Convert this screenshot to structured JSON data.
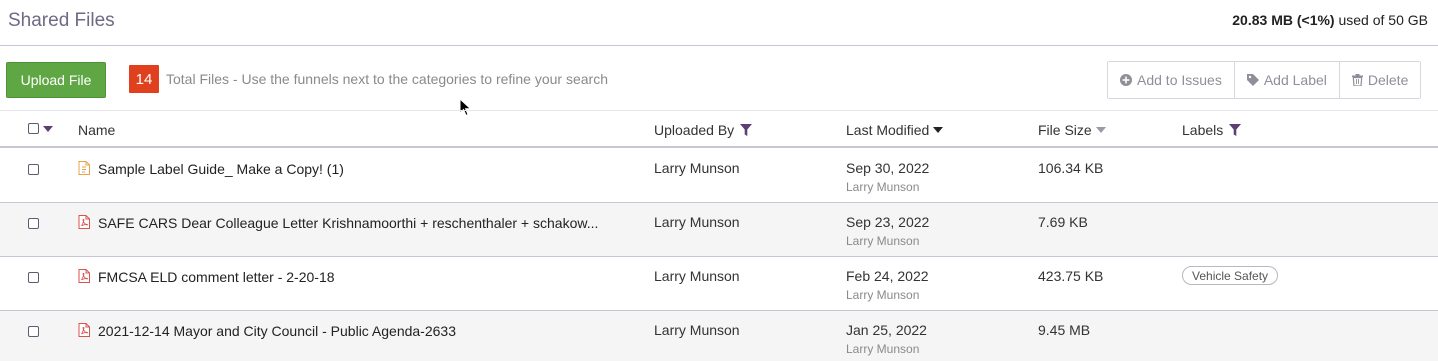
{
  "header": {
    "title": "Shared Files",
    "storage_used": "20.83 MB (<1%)",
    "storage_suffix": " used of 50 GB"
  },
  "toolbar": {
    "upload_label": "Upload File",
    "file_count": "14",
    "total_text": "Total Files - Use the funnels next to the categories to refine your search",
    "actions": [
      {
        "label": "Add to Issues",
        "icon": "plus-circle-icon"
      },
      {
        "label": "Add Label",
        "icon": "tag-icon"
      },
      {
        "label": "Delete",
        "icon": "trash-icon"
      }
    ]
  },
  "table": {
    "columns": {
      "name": "Name",
      "uploaded_by": "Uploaded By",
      "last_modified": "Last Modified",
      "file_size": "File Size",
      "labels": "Labels"
    },
    "rows": [
      {
        "name": "Sample Label Guide_ Make a Copy! (1)",
        "file_type": "doc",
        "uploaded_by": "Larry Munson",
        "modified_date": "Sep 30, 2022",
        "modified_by": "Larry Munson",
        "size": "106.34 KB",
        "label": ""
      },
      {
        "name": "SAFE CARS Dear Colleague Letter Krishnamoorthi + reschenthaler + schakow...",
        "file_type": "pdf",
        "uploaded_by": "Larry Munson",
        "modified_date": "Sep 23, 2022",
        "modified_by": "Larry Munson",
        "size": "7.69 KB",
        "label": ""
      },
      {
        "name": "FMCSA ELD comment letter - 2-20-18",
        "file_type": "pdf",
        "uploaded_by": "Larry Munson",
        "modified_date": "Feb 24, 2022",
        "modified_by": "Larry Munson",
        "size": "423.75 KB",
        "label": "Vehicle Safety"
      },
      {
        "name": "2021-12-14 Mayor and City Council - Public Agenda-2633",
        "file_type": "pdf",
        "uploaded_by": "Larry Munson",
        "modified_date": "Jan 25, 2022",
        "modified_by": "Larry Munson",
        "size": "9.45 MB",
        "label": ""
      }
    ]
  },
  "colors": {
    "accent_green": "#5fa744",
    "badge_red": "#e0401e",
    "title_purple": "#6d6a85",
    "pdf_red": "#d9534f",
    "doc_orange": "#e8a04a"
  }
}
